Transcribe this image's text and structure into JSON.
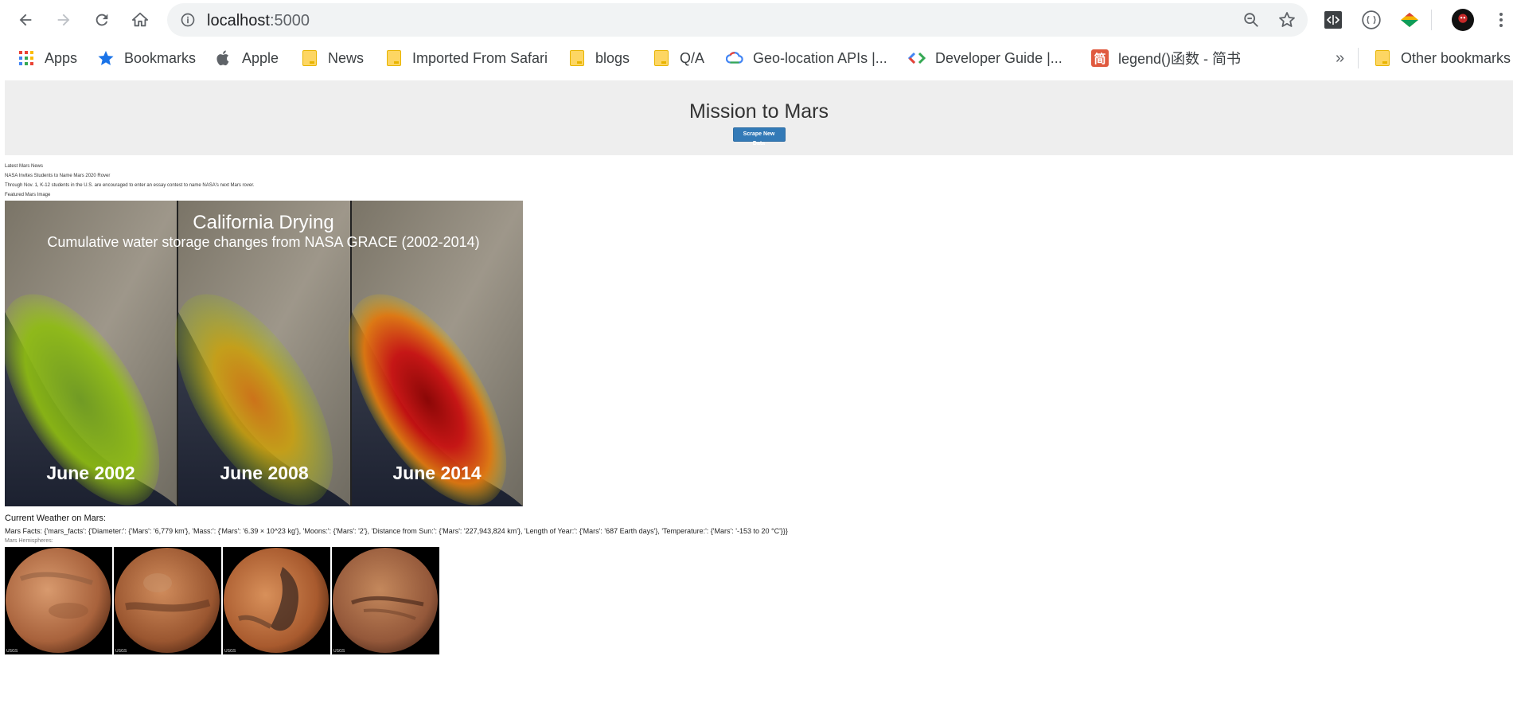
{
  "browser": {
    "url_host": "localhost",
    "url_port": ":5000",
    "bookmarks": [
      {
        "label": "Apps",
        "icon": "apps-grid-icon"
      },
      {
        "label": "Bookmarks",
        "icon": "star-icon"
      },
      {
        "label": "Apple",
        "icon": "apple-icon"
      },
      {
        "label": "News",
        "icon": "folder-icon"
      },
      {
        "label": "Imported From Safari",
        "icon": "folder-icon"
      },
      {
        "label": "blogs",
        "icon": "folder-icon"
      },
      {
        "label": "Q/A",
        "icon": "folder-icon"
      },
      {
        "label": "Geo-location APIs  |...",
        "icon": "google-cloud-icon"
      },
      {
        "label": "Developer Guide  |...",
        "icon": "developer-icon"
      },
      {
        "label": "legend()函数 - 简书",
        "icon": "jianshu-icon"
      }
    ],
    "overflow_label": "»",
    "other_bookmarks": "Other bookmarks",
    "jianshu_glyph": "简"
  },
  "page": {
    "title": "Mission to Mars",
    "scrape_button": "Scrape New Data",
    "news_heading": "Latest Mars News",
    "news_title": "NASA Invites Students to Name Mars 2020 Rover",
    "news_paragraph": "Through Nov. 1, K-12 students in the U.S. are encouraged to enter an essay contest to name NASA's next Mars rover.",
    "featured_heading": "Featured Mars Image",
    "featured_image": {
      "title": "California Drying",
      "subtitle": "Cumulative water storage changes from NASA GRACE (2002-2014)",
      "panels": [
        "June 2002",
        "June 2008",
        "June 2014"
      ]
    },
    "weather_label": "Current Weather on Mars:",
    "facts_text": "Mars Facts: {'mars_facts': {'Diameter:': {'Mars': '6,779 km'}, 'Mass:': {'Mars': '6.39 × 10^23 kg'}, 'Moons:': {'Mars': '2'}, 'Distance from Sun:': {'Mars': '227,943,824 km'}, 'Length of Year:': {'Mars': '687 Earth days'}, 'Temperature:': {'Mars': '-153 to 20 °C'}}}",
    "hemispheres_heading": "Mars Hemispheres:",
    "hemisphere_tag": "USGS",
    "colors": {
      "button": "#337ab7",
      "jumbotron": "#eeeeee"
    }
  }
}
